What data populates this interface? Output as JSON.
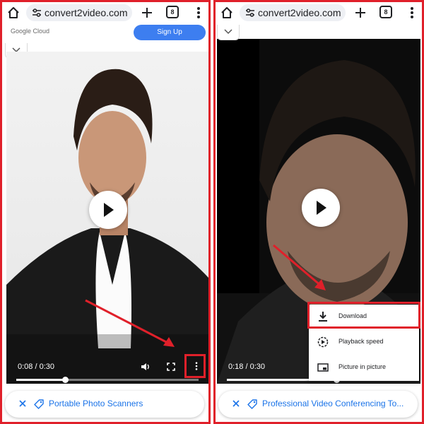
{
  "colors": {
    "annotation_red": "#e0202a",
    "link_blue": "#1a73e8",
    "signup_blue": "#3d7ef0"
  },
  "left": {
    "browser": {
      "url": "convert2video.com",
      "tab_count": "8"
    },
    "ad": {
      "brand": "Google Cloud",
      "signup_label": "Sign Up"
    },
    "video": {
      "time": "0:08 / 0:30",
      "progress": 0.267
    },
    "chip": {
      "text": "Portable Photo Scanners"
    }
  },
  "right": {
    "browser": {
      "url": "convert2video.com",
      "tab_count": "8"
    },
    "video": {
      "time": "0:18 / 0:30",
      "progress": 0.6
    },
    "menu": {
      "items": [
        {
          "label": "Download",
          "icon": "download-icon"
        },
        {
          "label": "Playback speed",
          "icon": "playback-speed-icon"
        },
        {
          "label": "Picture in picture",
          "icon": "picture-in-picture-icon"
        }
      ]
    },
    "chip": {
      "text": "Professional Video Conferencing To..."
    }
  }
}
